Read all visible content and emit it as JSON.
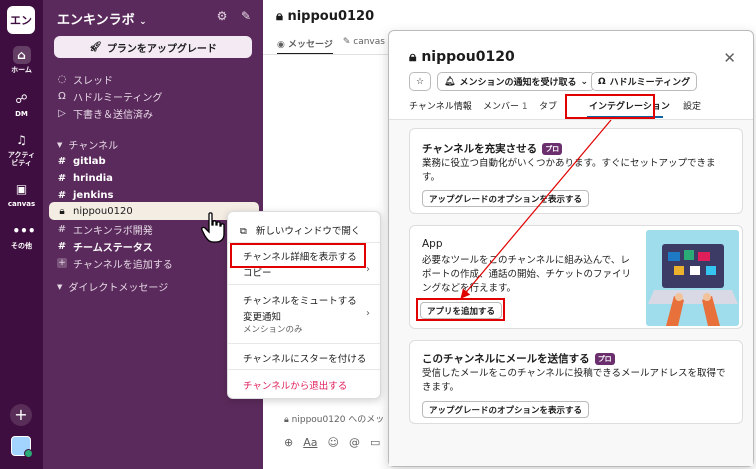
{
  "workspace": {
    "logo_text": "エン",
    "name": "エンキンラボ",
    "upgrade_label": "プランをアップグレード"
  },
  "rail": {
    "items": [
      {
        "label": "ホーム",
        "icon": "home-icon"
      },
      {
        "label": "DM",
        "icon": "dm-icon"
      },
      {
        "label_line1": "アクティ",
        "label_line2": "ビティ",
        "icon": "bell-icon"
      },
      {
        "label": "canvas",
        "icon": "canvas-icon"
      },
      {
        "label": "その他",
        "icon": "more-icon"
      }
    ]
  },
  "sidebar": {
    "nav": [
      {
        "label": "スレッド",
        "icon": "thread-icon"
      },
      {
        "label": "ハドルミーティング",
        "icon": "headphones-icon"
      },
      {
        "label": "下書き＆送信済み",
        "icon": "send-icon"
      }
    ],
    "channels_header": "チャンネル",
    "channels": [
      {
        "name": "gitlab",
        "bold": true,
        "prefix": "#"
      },
      {
        "name": "hrindia",
        "bold": true,
        "prefix": "#"
      },
      {
        "name": "jenkins",
        "bold": true,
        "prefix": "#"
      },
      {
        "name": "nippou0120",
        "bold": false,
        "prefix": "lock",
        "selected": true
      },
      {
        "name": "エンキンラボ開発",
        "bold": false,
        "prefix": "#"
      },
      {
        "name": "チームステータス",
        "bold": true,
        "prefix": "#"
      }
    ],
    "add_channel": "チャンネルを追加する",
    "dm_header": "ダイレクトメッセージ"
  },
  "main": {
    "title": "nippou0120",
    "tabs": [
      "メッセージ",
      "canvas"
    ],
    "composer_placeholder": "nippou0120 へのメッ"
  },
  "context_menu": {
    "new_window": "新しいウィンドウで開く",
    "show_details": "チャンネル詳細を表示する",
    "copy": "コピー",
    "mute": "チャンネルをミュートする",
    "notify": "変更通知",
    "notify_sub": "メンションのみ",
    "star": "チャンネルにスターを付ける",
    "leave": "チャンネルから退出する"
  },
  "modal": {
    "title": "nippou0120",
    "notify_pill": "メンションの通知を受け取る",
    "huddle_pill": "ハドルミーティング",
    "tabs": {
      "info": "チャンネル情報",
      "members": "メンバー",
      "members_count": "1",
      "tabs": "タブ",
      "integrations": "インテグレーション",
      "settings": "設定"
    },
    "card1": {
      "title": "チャンネルを充実させる",
      "badge": "プロ",
      "text": "業務に役立つ自動化がいくつかあります。すぐにセットアップできます。",
      "button": "アップグレードのオプションを表示する"
    },
    "card2": {
      "title": "App",
      "text_line1": "必要なツールをこのチャンネルに組み込んで、レ",
      "text_line2": "ポートの作成、通話の開始、チケットのファイリ",
      "text_line3": "ングなどを行えます。",
      "button": "アプリを追加する"
    },
    "card3": {
      "title": "このチャンネルにメールを送信する",
      "badge": "プロ",
      "text": "受信したメールをこのチャンネルに投稿できるメールアドレスを取得できます。",
      "button": "アップグレードのオプションを表示する"
    }
  },
  "colors": {
    "rail": "#3f0e40",
    "sidebar": "#5b2a5c",
    "highlight": "#e00000",
    "link_blue": "#1264a3",
    "danger": "#e01e5a"
  }
}
